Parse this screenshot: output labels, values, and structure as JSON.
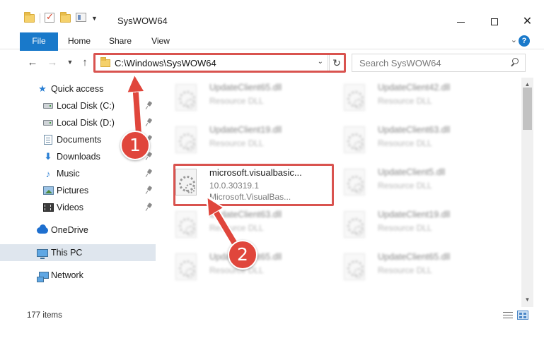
{
  "window": {
    "title": "SysWOW64",
    "controls": {
      "minimize": "",
      "maximize": "",
      "close": "✕"
    }
  },
  "ribbon": {
    "tabs": [
      "File",
      "Home",
      "Share",
      "View"
    ],
    "help": "?"
  },
  "address_bar": {
    "path": "C:\\Windows\\SysWOW64"
  },
  "search": {
    "placeholder": "Search SysWOW64"
  },
  "sidebar": {
    "items": [
      {
        "label": "Quick access",
        "icon": "star-icon"
      },
      {
        "label": "Local Disk (C:)",
        "icon": "disk-icon",
        "pinned": true
      },
      {
        "label": "Local Disk (D:)",
        "icon": "disk-icon",
        "pinned": true
      },
      {
        "label": "Documents",
        "icon": "documents-icon",
        "pinned": true
      },
      {
        "label": "Downloads",
        "icon": "download-icon",
        "pinned": true
      },
      {
        "label": "Music",
        "icon": "music-icon",
        "pinned": true
      },
      {
        "label": "Pictures",
        "icon": "pictures-icon",
        "pinned": true
      },
      {
        "label": "Videos",
        "icon": "videos-icon",
        "pinned": true
      },
      {
        "label": "OneDrive",
        "icon": "cloud-icon"
      },
      {
        "label": "This PC",
        "icon": "computer-icon",
        "selected": true
      },
      {
        "label": "Network",
        "icon": "network-icon"
      }
    ]
  },
  "files": [
    {
      "name": "UpdateClient65.dll",
      "type": "Resource DLL"
    },
    {
      "name": "UpdateClient42.dll",
      "type": "Resource DLL"
    },
    {
      "name": "UpdateClient19.dll",
      "type": "Resource DLL"
    },
    {
      "name": "UpdateClient63.dll",
      "type": "Resource DLL"
    },
    {
      "name": "microsoft.visualbasic...",
      "version": "10.0.30319.1",
      "type": "Microsoft.VisualBas..."
    },
    {
      "name": "UpdateClient5.dll",
      "type": "Resource DLL"
    },
    {
      "name": "UpdateClient63.dll",
      "type": "Resource DLL"
    },
    {
      "name": "UpdateClient19.dll",
      "type": "Resource DLL"
    },
    {
      "name": "UpdateClient65.dll",
      "type": "Resource DLL"
    },
    {
      "name": "UpdateClient65.dll",
      "type": "Resource DLL"
    }
  ],
  "status": {
    "item_count": "177 items"
  },
  "callouts": [
    {
      "number": "1"
    },
    {
      "number": "2"
    }
  ],
  "colors": {
    "accent": "#1979ca",
    "highlight": "#d9534f",
    "callout": "#e0463c",
    "folder": "#f5d16b"
  }
}
